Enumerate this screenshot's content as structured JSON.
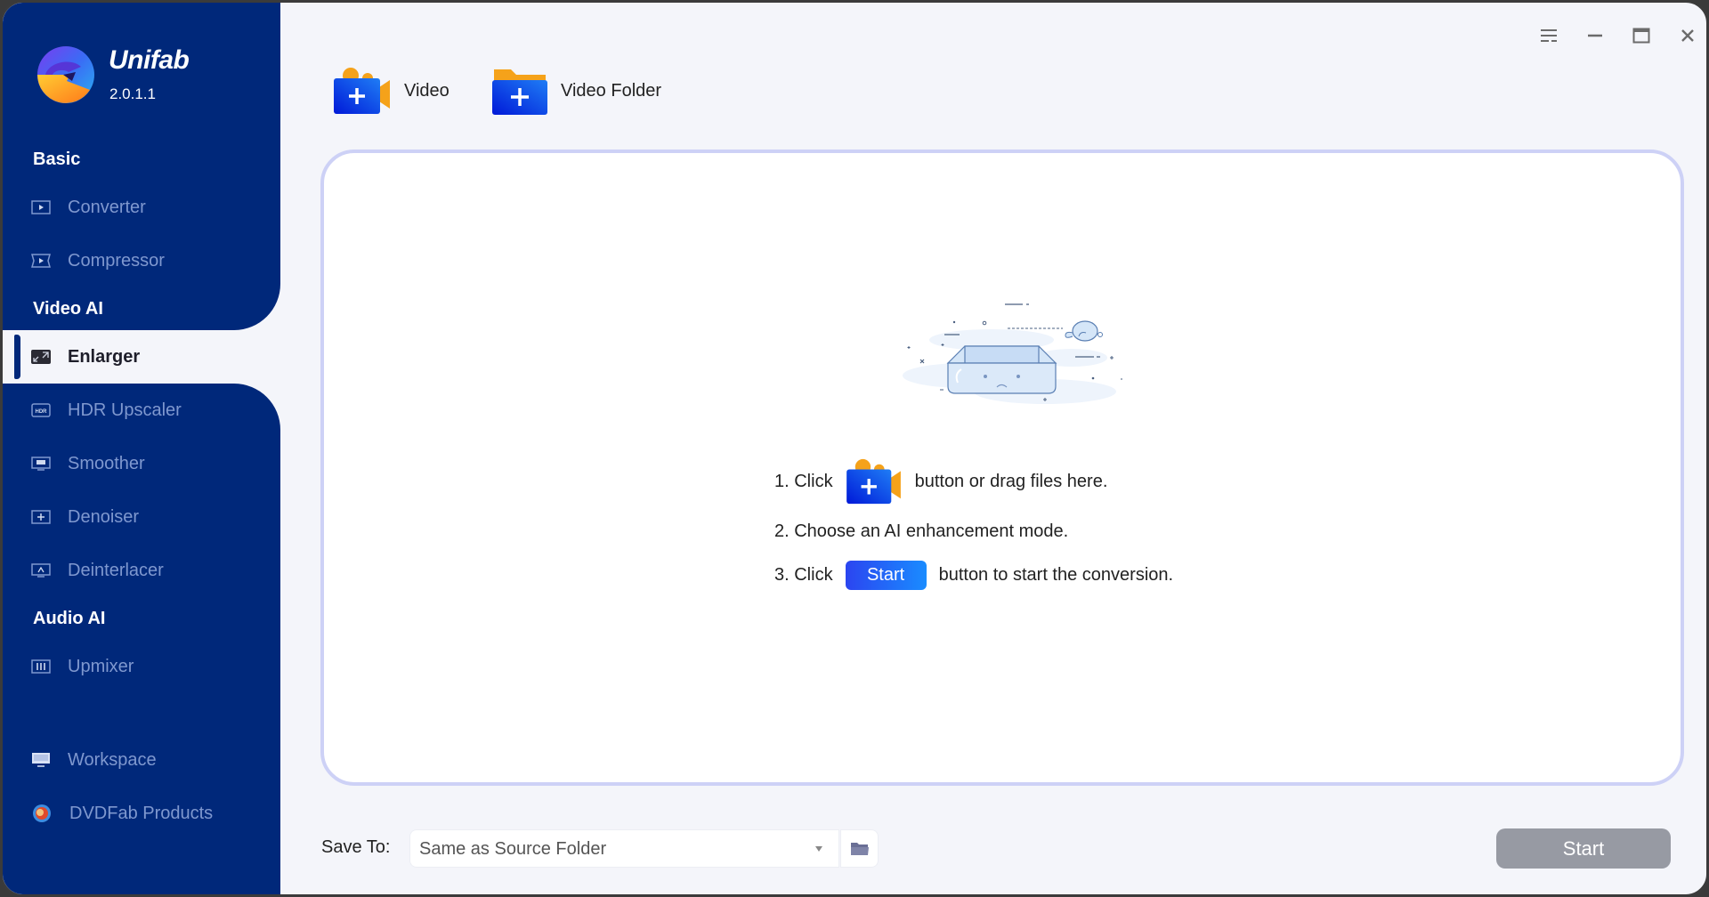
{
  "app": {
    "name": "Unifab",
    "version": "2.0.1.1"
  },
  "window_controls": {
    "menu": "menu-icon",
    "minimize": "minimize-icon",
    "maximize": "maximize-icon",
    "close": "close-icon"
  },
  "sidebar": {
    "sections": [
      {
        "label": "Basic"
      },
      {
        "label": "Video AI"
      },
      {
        "label": "Audio AI"
      }
    ],
    "items": [
      {
        "label": "Converter",
        "icon": "converter-icon"
      },
      {
        "label": "Compressor",
        "icon": "compressor-icon"
      },
      {
        "label": "Enlarger",
        "icon": "enlarger-icon",
        "active": true
      },
      {
        "label": "HDR Upscaler",
        "icon": "hdr-icon"
      },
      {
        "label": "Smoother",
        "icon": "smoother-icon"
      },
      {
        "label": "Denoiser",
        "icon": "denoiser-icon"
      },
      {
        "label": "Deinterlacer",
        "icon": "deinterlacer-icon"
      },
      {
        "label": "Upmixer",
        "icon": "upmixer-icon"
      },
      {
        "label": "Workspace",
        "icon": "monitor-icon"
      },
      {
        "label": "DVDFab Products",
        "icon": "dvdfab-icon"
      }
    ]
  },
  "toolbar": {
    "add_video": "Video",
    "add_folder": "Video Folder"
  },
  "dropzone": {
    "step1_prefix": "1. Click",
    "step1_suffix": "button or drag files here.",
    "step2": "2. Choose an AI enhancement mode.",
    "step3_prefix": "3. Click",
    "step3_chip": "Start",
    "step3_suffix": "button to start the conversion."
  },
  "footer": {
    "save_to_label": "Save To:",
    "save_to_value": "Same as Source Folder",
    "start_label": "Start"
  },
  "colors": {
    "sidebar_bg": "#00287a",
    "accent_blue": "#1a3cf0",
    "accent_orange": "#f5a21a",
    "dropzone_border": "#cdd1f6",
    "start_disabled": "#979aa3"
  }
}
